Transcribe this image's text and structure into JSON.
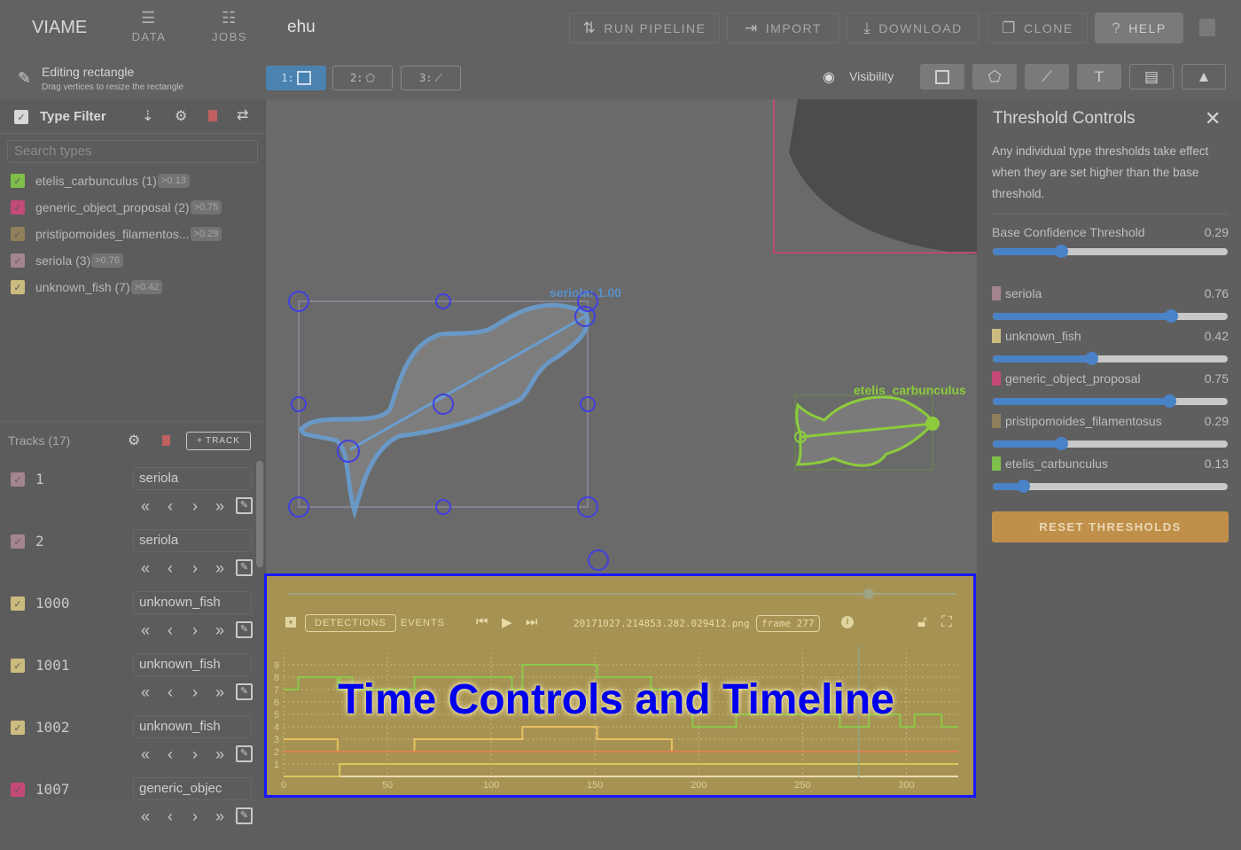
{
  "app": {
    "brand": "VIAME",
    "dataset_name": "ehu"
  },
  "nav": [
    {
      "label": "DATA",
      "icon": "database-icon"
    },
    {
      "label": "JOBS",
      "icon": "jobs-list-icon"
    }
  ],
  "toolbar": {
    "run_pipeline": "RUN PIPELINE",
    "import": "IMPORT",
    "download": "DOWNLOAD",
    "clone": "CLONE",
    "help": "HELP"
  },
  "edit_status": {
    "title": "Editing rectangle",
    "subtitle": "Drag vertices to resize the rectangle"
  },
  "edit_modes": [
    {
      "key": "1:",
      "icon": "rectangle-icon",
      "active": true
    },
    {
      "key": "2:",
      "icon": "polygon-icon",
      "active": false
    },
    {
      "key": "3:",
      "icon": "line-icon",
      "active": false
    }
  ],
  "visibility": {
    "label": "Visibility",
    "tools": [
      "rectangle-icon",
      "polygon-icon",
      "line-icon",
      "text-icon",
      "comment-icon",
      "arrow-icon"
    ]
  },
  "type_filter": {
    "title": "Type Filter",
    "search_placeholder": "Search types",
    "types": [
      {
        "label": "etelis_carbunculus (1)",
        "badge": ">0.13",
        "color": "#7ec04a"
      },
      {
        "label": "generic_object_proposal (2)",
        "badge": ">0.75",
        "color": "#c44a78"
      },
      {
        "label": "pristipomoides_filamentos...",
        "badge": ">0.29",
        "color": "#8f7f5a"
      },
      {
        "label": "seriola (3)",
        "badge": ">0.76",
        "color": "#a3858d"
      },
      {
        "label": "unknown_fish (7)",
        "badge": ">0.42",
        "color": "#cbbb7e"
      }
    ]
  },
  "tracks": {
    "title": "Tracks (17)",
    "add_label": "TRACK",
    "items": [
      {
        "id": "1",
        "type": "seriola",
        "color": "#a3858d"
      },
      {
        "id": "2",
        "type": "seriola",
        "color": "#a3858d"
      },
      {
        "id": "1000",
        "type": "unknown_fish",
        "color": "#cbbb7e"
      },
      {
        "id": "1001",
        "type": "unknown_fish",
        "color": "#cbbb7e"
      },
      {
        "id": "1002",
        "type": "unknown_fish",
        "color": "#cbbb7e"
      },
      {
        "id": "1007",
        "type": "generic_objec",
        "color": "#c44a78"
      }
    ]
  },
  "annotations": [
    {
      "label": "seriola: 1.00",
      "color": "#5a90c8"
    },
    {
      "label": "etelis_carbunculus",
      "color": "#8ccc3c"
    }
  ],
  "threshold": {
    "title": "Threshold Controls",
    "description": "Any individual type thresholds take effect when they are set higher than the base threshold.",
    "base_label": "Base Confidence Threshold",
    "base_value": "0.29",
    "types": [
      {
        "label": "seriola",
        "value": "0.76",
        "color": "#a3858d"
      },
      {
        "label": "unknown_fish",
        "value": "0.42",
        "color": "#cbbb7e"
      },
      {
        "label": "generic_object_proposal",
        "value": "0.75",
        "color": "#c44a78"
      },
      {
        "label": "pristipomoides_filamentosus",
        "value": "0.29",
        "color": "#8f7f5a"
      },
      {
        "label": "etelis_carbunculus",
        "value": "0.13",
        "color": "#7ec04a"
      }
    ],
    "reset_label": "RESET THRESHOLDS"
  },
  "timeline": {
    "detections_label": "DETECTIONS",
    "events_label": "EVENTS",
    "filename": "20171027.214853.282.029412.png",
    "frame_label": "frame 277",
    "seek_fraction": 0.87
  },
  "overlay_title": "Time Controls and Timeline",
  "chart_data": {
    "type": "line",
    "xlim": [
      0,
      325
    ],
    "ylim": [
      0,
      9
    ],
    "x_ticks": [
      "0",
      "50",
      "100",
      "150",
      "200",
      "250",
      "300"
    ],
    "y_ticks": [
      "1",
      "2",
      "3",
      "4",
      "5",
      "6",
      "7",
      "8",
      "9"
    ],
    "current_frame": 277,
    "series": [
      {
        "color": "#8cc84a",
        "points": [
          [
            0,
            7
          ],
          [
            7,
            8
          ],
          [
            26,
            7
          ],
          [
            27,
            8
          ],
          [
            33,
            7
          ],
          [
            63,
            8
          ],
          [
            110,
            7
          ],
          [
            115,
            9
          ],
          [
            151,
            8
          ],
          [
            177,
            7
          ],
          [
            185,
            6
          ],
          [
            197,
            4
          ],
          [
            218,
            5
          ],
          [
            268,
            4
          ],
          [
            282,
            5
          ],
          [
            297,
            4
          ],
          [
            304,
            5
          ],
          [
            317,
            4
          ],
          [
            325,
            4
          ]
        ]
      },
      {
        "color": "#e8c060",
        "points": [
          [
            0,
            3
          ],
          [
            26,
            2
          ],
          [
            63,
            3
          ],
          [
            115,
            4
          ],
          [
            151,
            3
          ],
          [
            187,
            2
          ],
          [
            325,
            2
          ]
        ]
      },
      {
        "color": "#e08050",
        "points": [
          [
            0,
            2
          ],
          [
            325,
            2
          ]
        ]
      },
      {
        "color": "#d8c860",
        "points": [
          [
            0,
            0
          ],
          [
            27,
            1
          ],
          [
            325,
            1
          ]
        ]
      }
    ]
  }
}
